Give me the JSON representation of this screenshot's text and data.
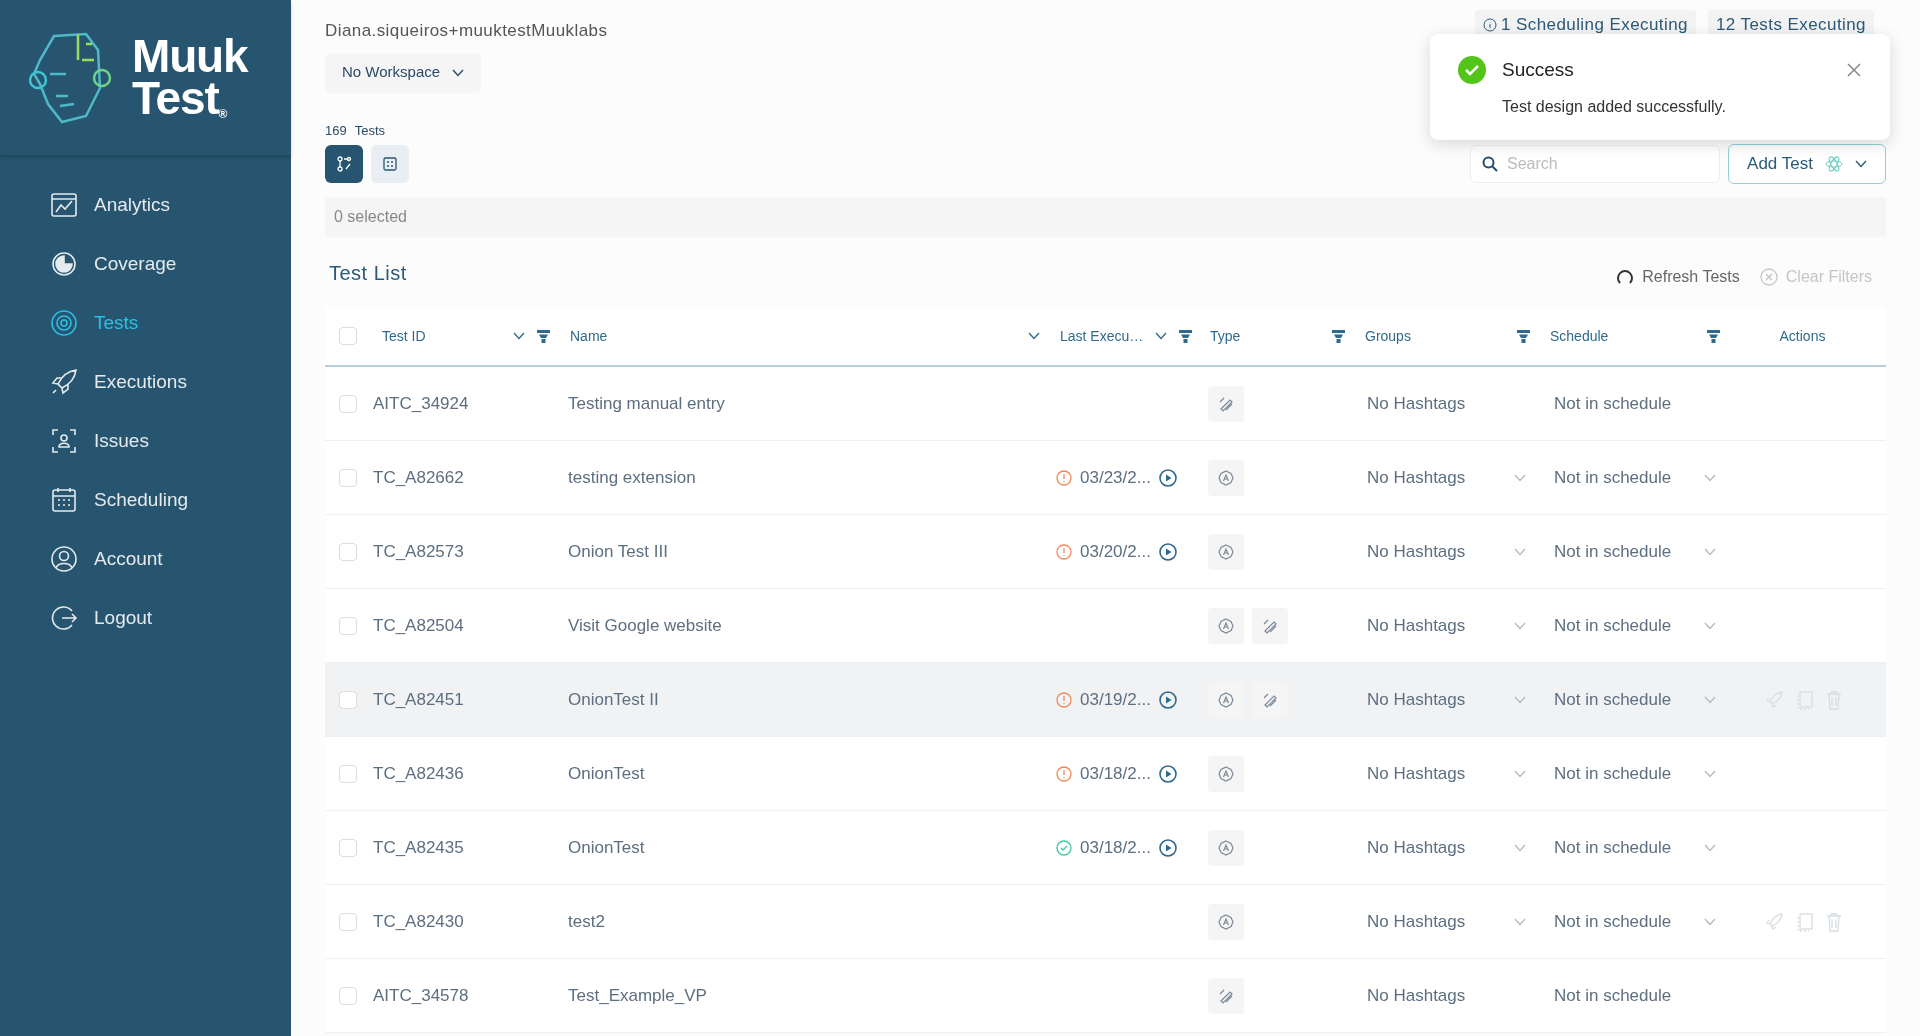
{
  "logo": {
    "line1": "Muuk",
    "line2": "Test",
    "mark": "®"
  },
  "sidebar": {
    "items": [
      {
        "label": "Analytics",
        "kind": "analytics",
        "selected": false
      },
      {
        "label": "Coverage",
        "kind": "coverage",
        "selected": false
      },
      {
        "label": "Tests",
        "kind": "tests",
        "selected": true
      },
      {
        "label": "Executions",
        "kind": "executions",
        "selected": false
      },
      {
        "label": "Issues",
        "kind": "issues",
        "selected": false
      },
      {
        "label": "Scheduling",
        "kind": "scheduling",
        "selected": false
      },
      {
        "label": "Account",
        "kind": "account",
        "selected": false
      },
      {
        "label": "Logout",
        "kind": "logout",
        "selected": false
      }
    ]
  },
  "user": "Diana.siqueiros+muuktestMuuklabs",
  "workspace": "No Workspace",
  "status_badges": [
    "1 Scheduling Executing",
    "12 Tests Executing"
  ],
  "test_count": {
    "number": "169",
    "label": "Tests"
  },
  "view_toggle": [
    {
      "kind": "flow",
      "selected": true
    },
    {
      "kind": "grid",
      "selected": false
    }
  ],
  "selection": "0 selected",
  "toast": {
    "title": "Success",
    "message": "Test design added successfully."
  },
  "search": {
    "placeholder": "Search"
  },
  "add_button": "Add Test",
  "list_title": "Test List",
  "refresh": "Refresh Tests",
  "clear_filters": "Clear Filters",
  "table": {
    "select_all_checked": false,
    "columns": [
      {
        "label": "Test ID",
        "sort": true,
        "filter": true
      },
      {
        "label": "Name",
        "sort": true,
        "filter": false
      },
      {
        "label": "Last Execu…",
        "sort": true,
        "filter": true
      },
      {
        "label": "Type",
        "sort": false,
        "filter": true
      },
      {
        "label": "Groups",
        "sort": false,
        "filter": true
      },
      {
        "label": "Schedule",
        "sort": false,
        "filter": true
      },
      {
        "label": "Actions",
        "sort": false,
        "filter": false
      }
    ],
    "rows": [
      {
        "checked": false,
        "id": "AITC_34924",
        "name": "Testing manual entry",
        "types": [
          {
            "kind": "manual"
          }
        ],
        "groups": "No Hashtags",
        "schedule": "Not in schedule",
        "dropdowns": false,
        "highlighted": false,
        "actions_visible": false
      },
      {
        "checked": false,
        "id": "TC_A82662",
        "name": "testing extension",
        "last_execution": {
          "kind": "warning",
          "date": "03/23/2..."
        },
        "types": [
          {
            "kind": "ai"
          }
        ],
        "groups": "No Hashtags",
        "schedule": "Not in schedule",
        "dropdowns": true,
        "highlighted": false,
        "actions_visible": false
      },
      {
        "checked": false,
        "id": "TC_A82573",
        "name": "Onion Test III",
        "last_execution": {
          "kind": "warning",
          "date": "03/20/2..."
        },
        "types": [
          {
            "kind": "ai"
          }
        ],
        "groups": "No Hashtags",
        "schedule": "Not in schedule",
        "dropdowns": true,
        "highlighted": false,
        "actions_visible": false
      },
      {
        "checked": false,
        "id": "TC_A82504",
        "name": "Visit Google website",
        "types": [
          {
            "kind": "ai"
          },
          {
            "kind": "manual"
          }
        ],
        "groups": "No Hashtags",
        "schedule": "Not in schedule",
        "dropdowns": true,
        "highlighted": false,
        "actions_visible": false
      },
      {
        "checked": false,
        "id": "TC_A82451",
        "name": "OnionTest II",
        "last_execution": {
          "kind": "warning",
          "date": "03/19/2..."
        },
        "types": [
          {
            "kind": "ai"
          },
          {
            "kind": "manual"
          }
        ],
        "groups": "No Hashtags",
        "schedule": "Not in schedule",
        "dropdowns": true,
        "highlighted": true,
        "actions_visible": true
      },
      {
        "checked": false,
        "id": "TC_A82436",
        "name": "OnionTest",
        "last_execution": {
          "kind": "warning",
          "date": "03/18/2..."
        },
        "types": [
          {
            "kind": "ai"
          }
        ],
        "groups": "No Hashtags",
        "schedule": "Not in schedule",
        "dropdowns": true,
        "highlighted": false,
        "actions_visible": false
      },
      {
        "checked": false,
        "id": "TC_A82435",
        "name": "OnionTest",
        "last_execution": {
          "kind": "success",
          "date": "03/18/2..."
        },
        "types": [
          {
            "kind": "ai"
          }
        ],
        "groups": "No Hashtags",
        "schedule": "Not in schedule",
        "dropdowns": true,
        "highlighted": false,
        "actions_visible": false
      },
      {
        "checked": false,
        "id": "TC_A82430",
        "name": "test2",
        "types": [
          {
            "kind": "ai"
          }
        ],
        "groups": "No Hashtags",
        "schedule": "Not in schedule",
        "dropdowns": true,
        "highlighted": false,
        "actions_visible": true
      },
      {
        "checked": false,
        "id": "AITC_34578",
        "name": "Test_Example_VP",
        "types": [
          {
            "kind": "manual"
          }
        ],
        "groups": "No Hashtags",
        "schedule": "Not in schedule",
        "dropdowns": false,
        "highlighted": false,
        "actions_visible": false
      }
    ]
  }
}
